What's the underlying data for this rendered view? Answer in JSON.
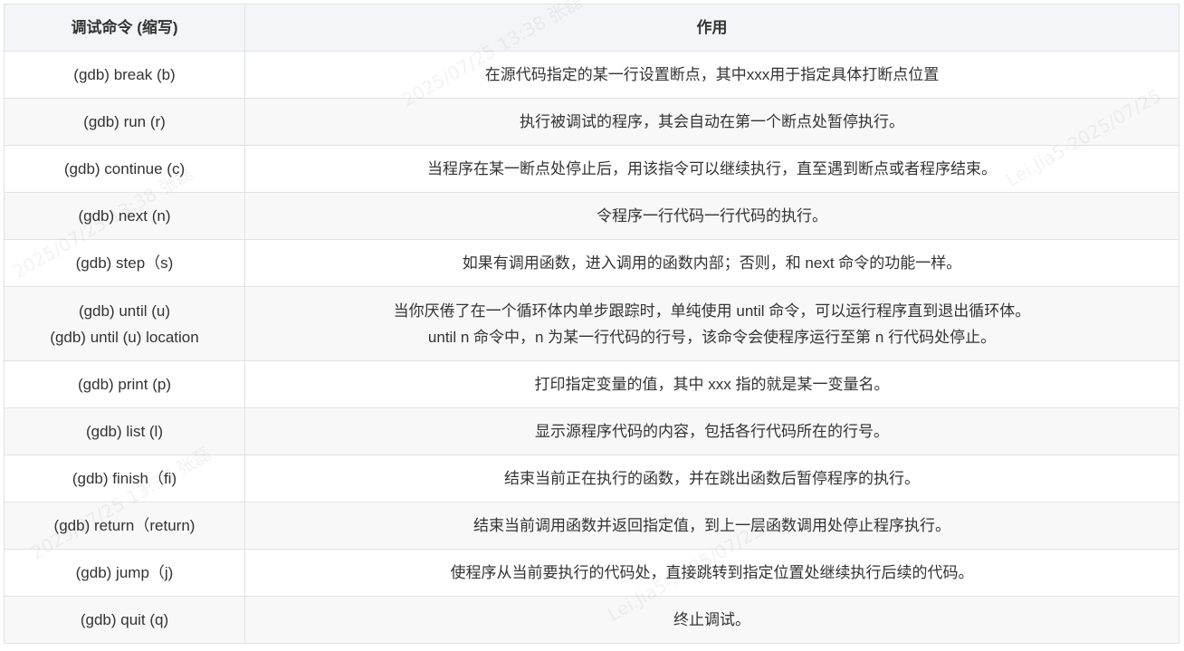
{
  "table": {
    "headers": [
      "调试命令 (缩写)",
      "作用"
    ],
    "rows": [
      {
        "cmd": [
          "(gdb) break (b)"
        ],
        "desc": [
          "在源代码指定的某一行设置断点，其中xxx用于指定具体打断点位置"
        ]
      },
      {
        "cmd": [
          "(gdb) run (r)"
        ],
        "desc": [
          "执行被调试的程序，其会自动在第一个断点处暂停执行。"
        ]
      },
      {
        "cmd": [
          "(gdb) continue (c)"
        ],
        "desc": [
          "当程序在某一断点处停止后，用该指令可以继续执行，直至遇到断点或者程序结束。"
        ]
      },
      {
        "cmd": [
          "(gdb) next (n)"
        ],
        "desc": [
          "令程序一行代码一行代码的执行。"
        ]
      },
      {
        "cmd": [
          "(gdb) step（s)"
        ],
        "desc": [
          "如果有调用函数，进入调用的函数内部；否则，和 next 命令的功能一样。"
        ]
      },
      {
        "cmd": [
          "(gdb) until (u)",
          "(gdb) until (u) location"
        ],
        "desc": [
          "当你厌倦了在一个循环体内单步跟踪时，单纯使用 until 命令，可以运行程序直到退出循环体。",
          "until n 命令中，n 为某一行代码的行号，该命令会使程序运行至第 n 行代码处停止。"
        ]
      },
      {
        "cmd": [
          "(gdb) print (p)"
        ],
        "desc": [
          "打印指定变量的值，其中 xxx 指的就是某一变量名。"
        ]
      },
      {
        "cmd": [
          "(gdb) list (l)"
        ],
        "desc": [
          "显示源程序代码的内容，包括各行代码所在的行号。"
        ]
      },
      {
        "cmd": [
          "(gdb) finish（fi)"
        ],
        "desc": [
          "结束当前正在执行的函数，并在跳出函数后暂停程序的执行。"
        ]
      },
      {
        "cmd": [
          "(gdb) return（return)"
        ],
        "desc": [
          "结束当前调用函数并返回指定值，到上一层函数调用处停止程序执行。"
        ]
      },
      {
        "cmd": [
          "(gdb) jump（j)"
        ],
        "desc": [
          "使程序从当前要执行的代码处，直接跳转到指定位置处继续执行后续的代码。"
        ]
      },
      {
        "cmd": [
          "(gdb) quit (q)"
        ],
        "desc": [
          "终止调试。"
        ]
      }
    ]
  },
  "watermark": {
    "text_1": "2025/07/25  13:38  张磊",
    "text_2": "Lei.Jia5-2025/07/25"
  }
}
